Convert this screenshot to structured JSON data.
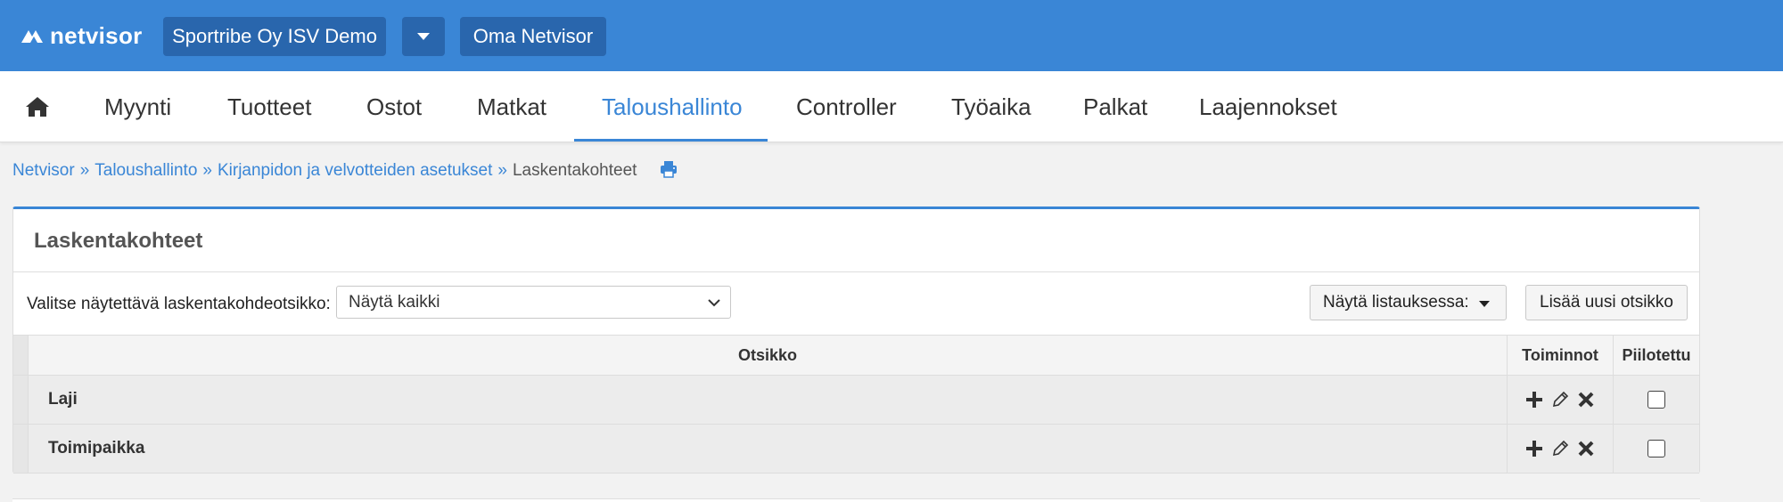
{
  "topbar": {
    "logo_text": "netvisor",
    "company_button": "Sportribe Oy ISV Demo",
    "oma_button": "Oma Netvisor"
  },
  "nav": {
    "items": [
      "Myynti",
      "Tuotteet",
      "Ostot",
      "Matkat",
      "Taloushallinto",
      "Controller",
      "Työaika",
      "Palkat",
      "Laajennokset"
    ],
    "active": "Taloushallinto",
    "accent_color": "#3a86d6"
  },
  "breadcrumb": {
    "links": [
      "Netvisor",
      "Taloushallinto",
      "Kirjanpidon ja velvotteiden asetukset"
    ],
    "separator": "»",
    "current": "Laskentakohteet"
  },
  "panel": {
    "title": "Laskentakohteet",
    "filter_label": "Valitse näytettävä laskentakohdeotsikko:",
    "filter_selected": "Näytä kaikki",
    "show_in_listing_button": "Näytä listauksessa:",
    "add_button": "Lisää uusi otsikko"
  },
  "table": {
    "headers": {
      "title": "Otsikko",
      "actions": "Toiminnot",
      "hidden": "Piilotettu"
    },
    "rows": [
      {
        "title": "Laji",
        "hidden": false
      },
      {
        "title": "Toimipaikka",
        "hidden": false
      }
    ]
  },
  "icons": {
    "home": "home-icon",
    "print": "print-icon",
    "add": "plus-icon",
    "edit": "pencil-icon",
    "delete": "close-icon"
  }
}
